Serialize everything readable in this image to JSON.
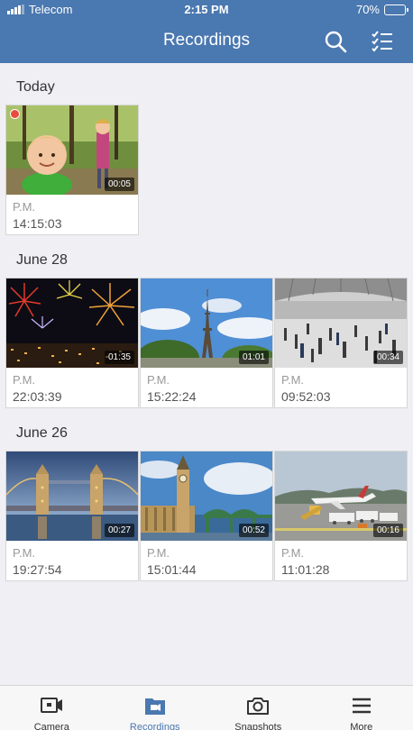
{
  "status_bar": {
    "carrier": "Telecom",
    "time": "2:15 PM",
    "battery": "70%",
    "battery_level": 0.7
  },
  "header": {
    "title": "Recordings",
    "icons": [
      "search-icon",
      "checklist-icon"
    ]
  },
  "sections": [
    {
      "title": "Today",
      "items": [
        {
          "ampm": "P.M.",
          "time": "14:15:03",
          "duration": "00:05",
          "recording": true,
          "thumb": "kids-in-forest"
        }
      ]
    },
    {
      "title": "June 28",
      "items": [
        {
          "ampm": "P.M.",
          "time": "22:03:39",
          "duration": "01:35",
          "thumb": "fireworks"
        },
        {
          "ampm": "P.M.",
          "time": "15:22:24",
          "duration": "01:01",
          "thumb": "eiffel-tower"
        },
        {
          "ampm": "P.M.",
          "time": "09:52:03",
          "duration": "00:34",
          "thumb": "train-station"
        }
      ]
    },
    {
      "title": "June 26",
      "items": [
        {
          "ampm": "P.M.",
          "time": "19:27:54",
          "duration": "00:27",
          "thumb": "tower-bridge"
        },
        {
          "ampm": "P.M.",
          "time": "15:01:44",
          "duration": "00:52",
          "thumb": "big-ben"
        },
        {
          "ampm": "P.M.",
          "time": "11:01:28",
          "duration": "00:16",
          "thumb": "airport"
        }
      ]
    }
  ],
  "tabbar": [
    {
      "label": "Camera",
      "icon": "camera-icon"
    },
    {
      "label": "Recordings",
      "icon": "recordings-icon",
      "active": true
    },
    {
      "label": "Snapshots",
      "icon": "snapshot-icon"
    },
    {
      "label": "More",
      "icon": "menu-icon"
    }
  ],
  "colors": {
    "accent": "#4a78b0",
    "recording_dot": "#e74c3c"
  }
}
